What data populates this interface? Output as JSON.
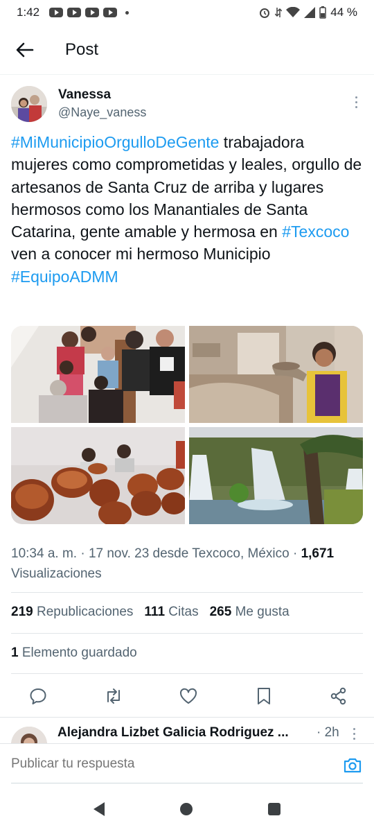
{
  "status_bar": {
    "time": "1:42",
    "battery": "44 %"
  },
  "header": {
    "title": "Post"
  },
  "post": {
    "author_name": "Vanessa",
    "author_handle": "@Naye_vaness",
    "text_segments": [
      {
        "text": "#MiMunicipioOrgulloDeGente",
        "type": "hashtag"
      },
      {
        "text": "  trabajadora mujeres como comprometidas y leales, orgullo de artesanos de Santa Cruz de arriba y lugares hermosos como los Manantiales de Santa Catarina, gente amable y hermosa en ",
        "type": "text"
      },
      {
        "text": "#Texcoco",
        "type": "hashtag"
      },
      {
        "text": " ven a conocer mi hermoso Municipio",
        "type": "text"
      },
      {
        "text": "#EquipoADMM",
        "type": "hashtag_block"
      }
    ],
    "meta_time": "10:34 a. m. · 17 nov. 23 desde Texcoco, México ·",
    "views_count": "1,671",
    "views_label": "Visualizaciones",
    "reposts_count": "219",
    "reposts_label": "Republicaciones",
    "quotes_count": "111",
    "quotes_label": "Citas",
    "likes_count": "265",
    "likes_label": "Me gusta",
    "saved_count": "1",
    "saved_label": "Elemento guardado"
  },
  "reply_preview": {
    "name": "Alejandra Lizbet Galicia Rodriguez ...",
    "time": "· 2h"
  },
  "composer": {
    "placeholder": "Publicar tu respuesta"
  },
  "icons": {
    "back": "arrow-left-icon",
    "reply": "comment-icon",
    "repost": "repost-icon",
    "like": "heart-icon",
    "bookmark": "bookmark-icon",
    "share": "share-icon",
    "camera": "camera-icon"
  },
  "colors": {
    "accent": "#1d9bf0",
    "text_primary": "#0f1419",
    "text_secondary": "#536471"
  }
}
